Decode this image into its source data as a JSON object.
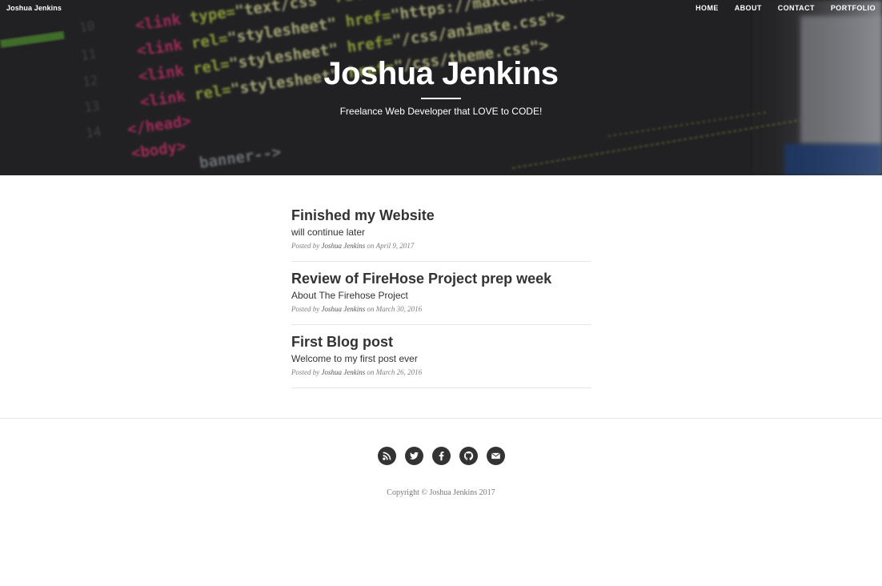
{
  "nav": {
    "brand": "Joshua Jenkins",
    "links": [
      "HOME",
      "ABOUT",
      "CONTACT",
      "PORTFOLIO"
    ]
  },
  "hero": {
    "title": "Joshua Jenkins",
    "subtitle": "Freelance Web Developer that LOVE to CODE!",
    "background_code_lines": [
      "<link type=\"text/css\" rel=\"stylesheet\"",
      "<link rel=\"stylesheet\" href=\"https://maxcdn.bootstrapcdn.com/font-aw",
      "<link rel=\"stylesheet\" href=\"/css/animate.css\">",
      "<link rel=\"stylesheet\" href=\"/css/theme.css\">",
      "</head>",
      "<body>",
      "banner-->"
    ]
  },
  "posts": [
    {
      "title": "Finished my Website",
      "subtitle": "will continue later",
      "meta_prefix": "Posted by",
      "author": "Joshua Jenkins",
      "meta_on": "on April 9, 2017"
    },
    {
      "title": "Review of FireHose Project prep week",
      "subtitle": "About The Firehose Project",
      "meta_prefix": "Posted by",
      "author": "Joshua Jenkins",
      "meta_on": "on March 30, 2016"
    },
    {
      "title": "First Blog post",
      "subtitle": "Welcome to my first post ever",
      "meta_prefix": "Posted by",
      "author": "Joshua Jenkins",
      "meta_on": "on March 26, 2016"
    }
  ],
  "footer": {
    "social_icons": [
      "rss-icon",
      "twitter-icon",
      "facebook-icon",
      "github-icon",
      "envelope-icon"
    ],
    "copyright": "Copyright © Joshua Jenkins 2017"
  },
  "colors": {
    "hero_bg": "#2b2b2d",
    "text": "#333333",
    "meta": "#808080",
    "divider": "#e6e6e6",
    "icon_bg": "#333333"
  }
}
